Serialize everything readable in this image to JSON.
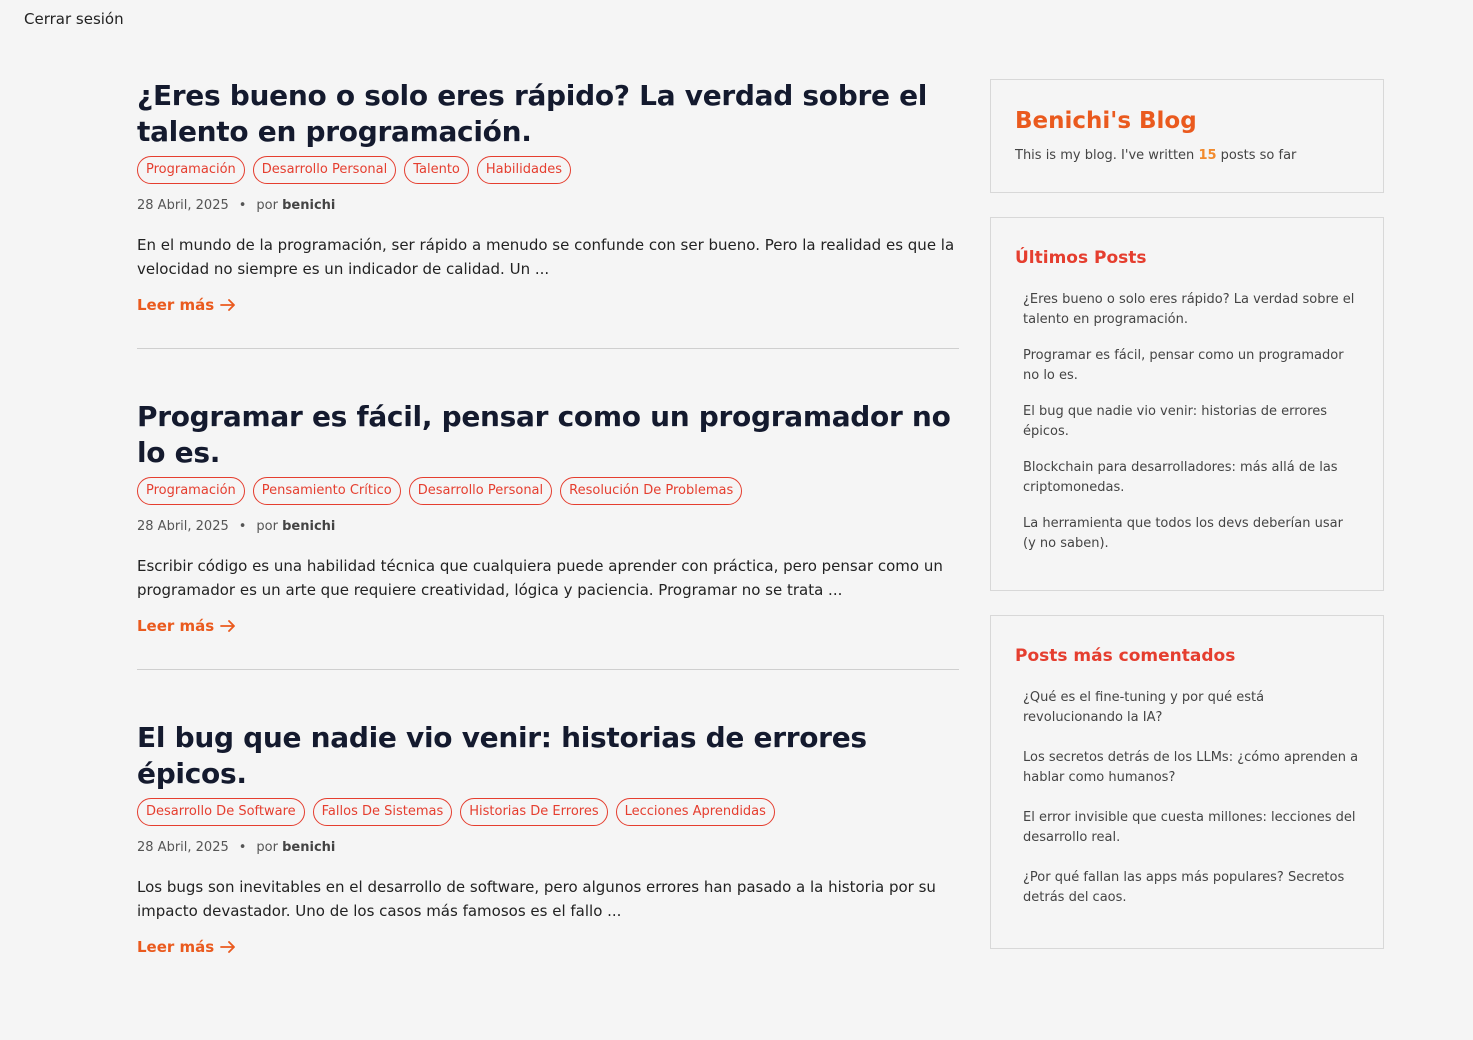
{
  "header": {
    "logout_label": "Cerrar sesión"
  },
  "posts": [
    {
      "title": "¿Eres bueno o solo eres rápido? La verdad sobre el talento en programación.",
      "tags": [
        "Programación",
        "Desarrollo Personal",
        "Talento",
        "Habilidades"
      ],
      "date": "28 Abril, 2025",
      "by": "por",
      "author": "benichi",
      "excerpt": "En el mundo de la programación, ser rápido a menudo se confunde con ser bueno. Pero la realidad es que la velocidad no siempre es un indicador de calidad. Un ...",
      "read_more": "Leer más"
    },
    {
      "title": "Programar es fácil, pensar como un programador no lo es.",
      "tags": [
        "Programación",
        "Pensamiento Crítico",
        "Desarrollo Personal",
        "Resolución De Problemas"
      ],
      "date": "28 Abril, 2025",
      "by": "por",
      "author": "benichi",
      "excerpt": "Escribir código es una habilidad técnica que cualquiera puede aprender con práctica, pero pensar como un programador es un arte que requiere creatividad, lógica y paciencia. Programar no se trata ...",
      "read_more": "Leer más"
    },
    {
      "title": "El bug que nadie vio venir: historias de errores épicos.",
      "tags": [
        "Desarrollo De Software",
        "Fallos De Sistemas",
        "Historias De Errores",
        "Lecciones Aprendidas"
      ],
      "date": "28 Abril, 2025",
      "by": "por",
      "author": "benichi",
      "excerpt": "Los bugs son inevitables en el desarrollo de software, pero algunos errores han pasado a la historia por su impacto devastador. Uno de los casos más famosos es el fallo ...",
      "read_more": "Leer más"
    }
  ],
  "sidebar": {
    "about": {
      "title": "Benichi's Blog",
      "desc_prefix": "This is my blog. I've written",
      "count": "15",
      "desc_suffix": "posts so far"
    },
    "latest": {
      "title": "Últimos Posts",
      "items": [
        "¿Eres bueno o solo eres rápido? La verdad sobre el talento en programación.",
        "Programar es fácil, pensar como un programador no lo es.",
        "El bug que nadie vio venir: historias de errores épicos.",
        "Blockchain para desarrolladores: más allá de las criptomonedas.",
        "La herramienta que todos los devs deberían usar (y no saben)."
      ]
    },
    "most_commented": {
      "title": "Posts más comentados",
      "items": [
        "¿Qué es el fine-tuning y por qué está revolucionando la IA?",
        "Los secretos detrás de los LLMs: ¿cómo aprenden a hablar como humanos?",
        "El error invisible que cuesta millones: lecciones del desarrollo real.",
        "¿Por qué fallan las apps más populares? Secretos detrás del caos."
      ]
    }
  },
  "colors": {
    "accent": "#ea5a1e",
    "tag": "#e53e2f",
    "title": "#141a2e"
  }
}
